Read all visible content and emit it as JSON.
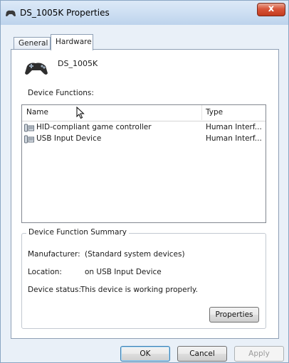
{
  "window": {
    "title": "DS_1005K Properties",
    "close_glyph": "x"
  },
  "tabs": [
    {
      "label": "General"
    },
    {
      "label": "Hardware"
    }
  ],
  "device": {
    "name": "DS_1005K",
    "icon": "gamepad-icon"
  },
  "device_functions": {
    "label": "Device Functions:",
    "columns": {
      "name": "Name",
      "type": "Type"
    },
    "rows": [
      {
        "name": "HID-compliant game controller",
        "type": "Human Interf...",
        "icon": "hid-device-icon"
      },
      {
        "name": "USB Input Device",
        "type": "Human Interf...",
        "icon": "hid-device-icon"
      }
    ]
  },
  "summary": {
    "title": "Device Function Summary",
    "manufacturer_label": "Manufacturer:",
    "manufacturer_value": "(Standard system devices)",
    "location_label": "Location:",
    "location_value": "on USB Input Device",
    "status_label": "Device status:",
    "status_value": "This device is working properly.",
    "properties_button": "Properties"
  },
  "buttons": {
    "ok": "OK",
    "cancel": "Cancel",
    "apply": "Apply"
  },
  "colors": {
    "title_bar": "#cfe0f3",
    "close_button": "#d8553a",
    "window_frame": "#e9f0f8"
  }
}
